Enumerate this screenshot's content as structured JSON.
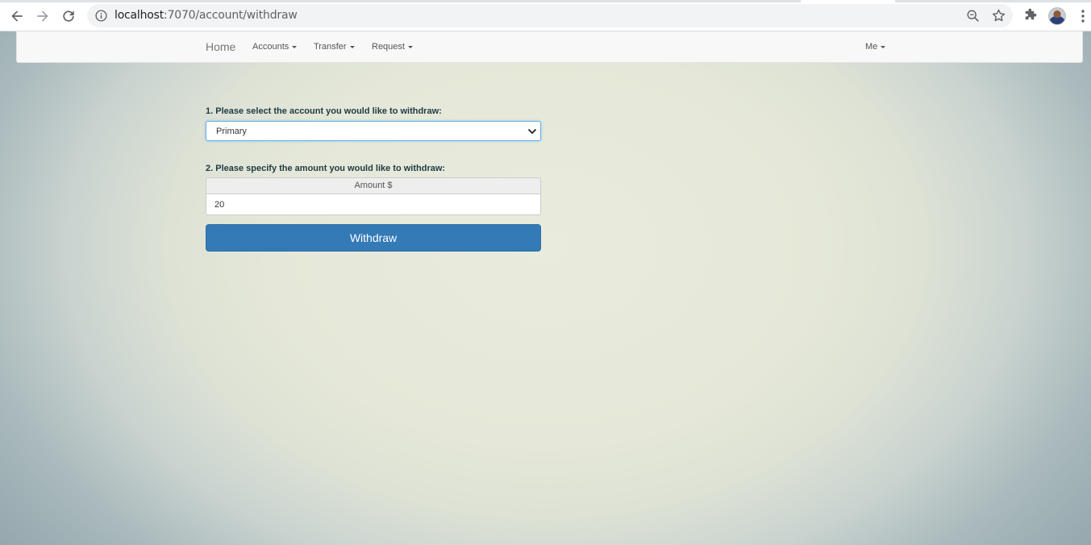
{
  "browser": {
    "url_host": "localhost",
    "url_rest": ":7070/account/withdraw",
    "icons": [
      "back-icon",
      "forward-icon",
      "reload-icon",
      "info-icon",
      "zoom-icon",
      "bookmark-star-icon",
      "extensions-icon",
      "profile-avatar",
      "menu-dots-icon"
    ]
  },
  "navbar": {
    "brand": "Home",
    "menus": [
      {
        "label": "Accounts"
      },
      {
        "label": "Transfer"
      },
      {
        "label": "Request"
      }
    ],
    "user_menu": "Me"
  },
  "withdraw_form": {
    "step1_label": "1. Please select the account you would like to withdraw:",
    "account_selected": "Primary",
    "step2_label": "2. Please specify the amount you would like to withdraw:",
    "amount_addon": "Amount $",
    "amount_value": "20",
    "submit_label": "Withdraw"
  },
  "colors": {
    "primary_button": "#337ab7",
    "focus_border": "#66afe9",
    "label_text": "#1d3a45"
  }
}
